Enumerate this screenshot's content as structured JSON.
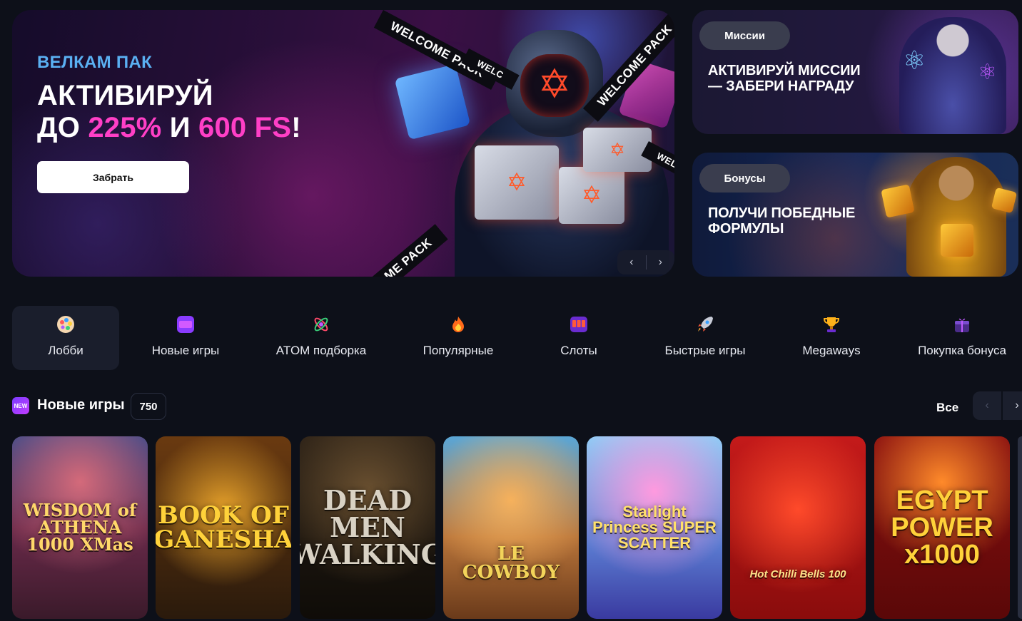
{
  "hero": {
    "subtitle": "ВЕЛКАМ ПАК",
    "title_line1": "АКТИВИРУЙ",
    "title_do": "ДО ",
    "title_percent": "225%",
    "title_and": " И ",
    "title_fs": "600 FS",
    "title_bang": "!",
    "button_label": "Забрать",
    "ribbon_text": "WELCOME PACK",
    "ribbon_short": "WELC",
    "ribbon_bottom": "ME PACK",
    "nav_prev": "‹",
    "nav_next": "›"
  },
  "promos": [
    {
      "pill": "Миссии",
      "text_line1": "АКТИВИРУЙ МИССИИ",
      "text_line2": "— ЗАБЕРИ НАГРАДУ"
    },
    {
      "pill": "Бонусы",
      "text_line1": "ПОЛУЧИ ПОБЕДНЫЕ",
      "text_line2": "ФОРМУЛЫ"
    }
  ],
  "categories": [
    {
      "label": "Лобби",
      "icon": "palette-icon",
      "active": true
    },
    {
      "label": "Новые игры",
      "icon": "new-badge-icon"
    },
    {
      "label": "ATOM подборка",
      "icon": "atom-icon"
    },
    {
      "label": "Популярные",
      "icon": "fire-icon"
    },
    {
      "label": "Слоты",
      "icon": "slot-machine-icon"
    },
    {
      "label": "Быстрые игры",
      "icon": "rocket-icon"
    },
    {
      "label": "Megaways",
      "icon": "trophy-icon"
    },
    {
      "label": "Покупка бонуса",
      "icon": "buy-gift-icon"
    }
  ],
  "section": {
    "icon_text": "NEW",
    "title": "Новые игры",
    "count": "750",
    "all_label": "Все",
    "prev": "‹",
    "next": "›"
  },
  "games": [
    {
      "title": "WISDOM of ATHENA 1000 XMas"
    },
    {
      "title": "BOOK OF GANESHA"
    },
    {
      "title": "DEAD MEN WALKING"
    },
    {
      "title": "LE COWBOY"
    },
    {
      "title": "Starlight Princess SUPER SCATTER"
    },
    {
      "title": "Hot Chilli Bells 100"
    },
    {
      "title": "EGYPT POWER x1000"
    }
  ],
  "colors": {
    "background": "#0d1019",
    "accent_pink": "#ff3fc6",
    "accent_blue": "#5ab0f2"
  }
}
